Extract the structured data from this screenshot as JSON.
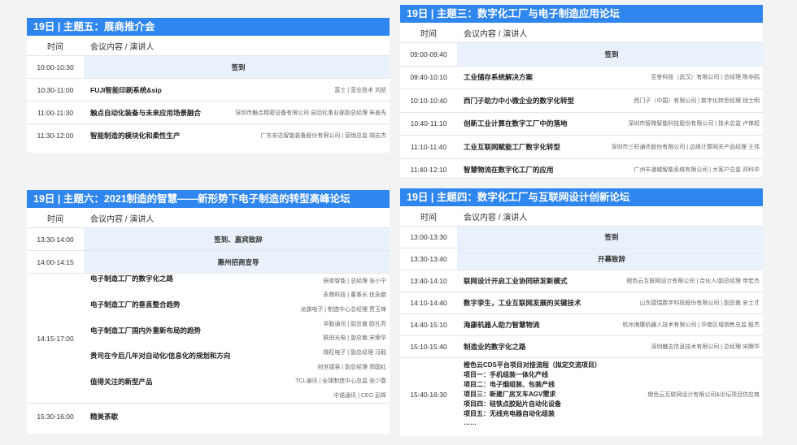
{
  "panels": {
    "p5": {
      "header": "19日 | 主题五：展商推介会",
      "col_time": "时间",
      "col_content": "会议内容 / 演讲人",
      "rows": [
        {
          "time": "10:00-10:30",
          "title": "签到",
          "highlight": true
        },
        {
          "time": "10:30-11:00",
          "title": "FUJI智能印刷系统&sip",
          "speaker": "富士 | 营业技术 刘凯"
        },
        {
          "time": "11:00-11:30",
          "title": "触点自动化装备与未来应用场景融合",
          "speaker": "深圳市触点精密设备有限公司 自动化事业部副总经理 朱善先"
        },
        {
          "time": "11:30-12:00",
          "title": "智能制造的模块化和柔性生产",
          "speaker": "广东安达智能装备股份有限公司 | 营销总监 胡志杰"
        }
      ]
    },
    "p3": {
      "header": "19日 | 主题三：数字化工厂与电子制造应用论坛",
      "col_time": "时间",
      "col_content": "会议内容 / 演讲人",
      "rows": [
        {
          "time": "09:00-09:40",
          "title": "签到",
          "highlight": true
        },
        {
          "time": "09:40-10:10",
          "title": "工业储存系统解决方案",
          "speaker": "至誉科技（武汉）有限公司 | 总经理 陈非鸥"
        },
        {
          "time": "10:10-10:40",
          "title": "西门子助力中小微企业的数字化转型",
          "speaker": "西门子（中国）有限公司 | 数字化转型经理 钱士明"
        },
        {
          "time": "10:40-11:10",
          "title": "创新工业计算在数字工厂中的落地",
          "speaker": "深圳市智微智能科技股份有限公司 | 技术总监 卢锋超"
        },
        {
          "time": "11:10-11:40",
          "title": "工业互联网赋能工厂数字化转型",
          "speaker": "深圳市三旺通信股份有限公司 | 边缘计算网关产品经理 王伟"
        },
        {
          "time": "11:40-12:10",
          "title": "智慧物流在数字化工厂的应用",
          "speaker": "广州丰速威智能系统有限公司 | 大客户总监 邓科华"
        }
      ]
    },
    "p6": {
      "header": "19日 | 主题六：2021制造的智慧——新形势下电子制造的转型高峰论坛",
      "col_time": "时间",
      "col_content": "会议内容 / 演讲人",
      "rows": [
        {
          "time": "13:30-14:00",
          "title": "签到、嘉宾致辞",
          "highlight": true
        },
        {
          "time": "14:00-14:15",
          "title": "惠州招商宣导",
          "highlight": true
        }
      ],
      "group": {
        "time": "14:15-17:00",
        "titles": [
          "电子制造工厂的数字化之路",
          "电子制造工厂的垂直整合趋势",
          "电子制造工厂国内外重新布局的趋势",
          "贵司在今后几年对自动化/信息化的规划和方向",
          "值得关注的新型产品"
        ],
        "speakers": [
          "辰奕智能 | 总经理 张小宁",
          "永鼎科技 | 董事长 伏永鹏",
          "龙旗电子 | 制造中心总经理 贾玉锋",
          "华勤通讯 | 副总裁 欧孔亮",
          "联创光电 | 副总裁 宋荣华",
          "晓旺电子 | 副总经理 冯毅",
          "创世捷易 | 副总经理 郑国红",
          "TCL通讯 | 全球制造中心总监 张少春",
          "中诺通讯 | CEO 彭辉"
        ]
      },
      "tail": {
        "time": "15:30-16:00",
        "title": "精美茶歇"
      }
    },
    "p4": {
      "header": "19日 | 主题四：数字化工厂与互联网设计创新论坛",
      "col_time": "时间",
      "col_content": "会议内容 / 演讲人",
      "rows": [
        {
          "time": "13:00-13:30",
          "title": "签到",
          "highlight": true
        },
        {
          "time": "13:30-13:40",
          "title": "开幕致辞",
          "highlight": true
        },
        {
          "time": "13:40-14:10",
          "title": "联网设计开启工业协同研发新模式",
          "speaker": "橙色云互联网设计有限公司 | 合伙人/副总经理 申宏杰"
        },
        {
          "time": "14:10-14:40",
          "title": "数字孪生，工业互联网发展的关键技术",
          "speaker": "山东捷瑞数字科技股份有限公司 | 副总裁 安士才"
        },
        {
          "time": "14:40-15:10",
          "title": "海康机器人助力智慧物流",
          "speaker": "杭州海康机器人技术有限公司 | 华南区域销售总监 殷杰"
        },
        {
          "time": "15:10-15:40",
          "title": "制造业的数字化之路",
          "speaker": "深圳魅志信息技术有限公司 | 总经理 宋腾华"
        }
      ],
      "tail": {
        "time": "15:40-16:30",
        "lines": [
          "橙色云CDS平台项目对接流程（拟定交流项目）",
          "项目一：手机组装一体化产线",
          "项目二：电子烟组装、包装产线",
          "项目三：新建厂房叉车AGV需求",
          "项目四：硅铁点胶贴片自动化设备",
          "项目五：无线充电器自动化组装",
          "……"
        ],
        "speaker": "橙色云互联网设计有限公司&论坛项目供应商"
      }
    }
  }
}
